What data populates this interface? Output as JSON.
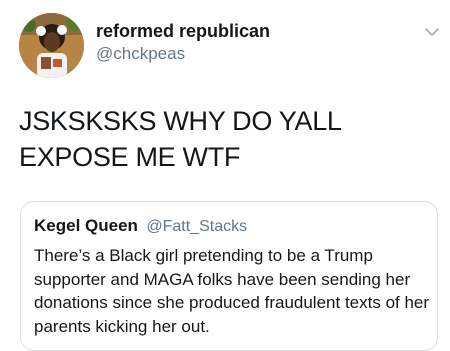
{
  "tweet": {
    "author": {
      "display_name": "reformed republican",
      "handle": "@chckpeas",
      "avatar_icon": "profile-photo"
    },
    "menu_icon": "chevron-down-icon",
    "text": "JSKSKSKS WHY DO YALL EXPOSE ME WTF"
  },
  "quoted_tweet": {
    "author": {
      "display_name": "Kegel Queen",
      "handle": "@Fatt_Stacks"
    },
    "text": "There’s a Black girl pretending to be a Trump supporter and MAGA folks have been sending her donations since she produced fraudulent texts of her parents kicking her out."
  },
  "colors": {
    "primary_text": "#14171a",
    "secondary_text": "#657786",
    "border": "#d9dee3",
    "background": "#ffffff"
  }
}
